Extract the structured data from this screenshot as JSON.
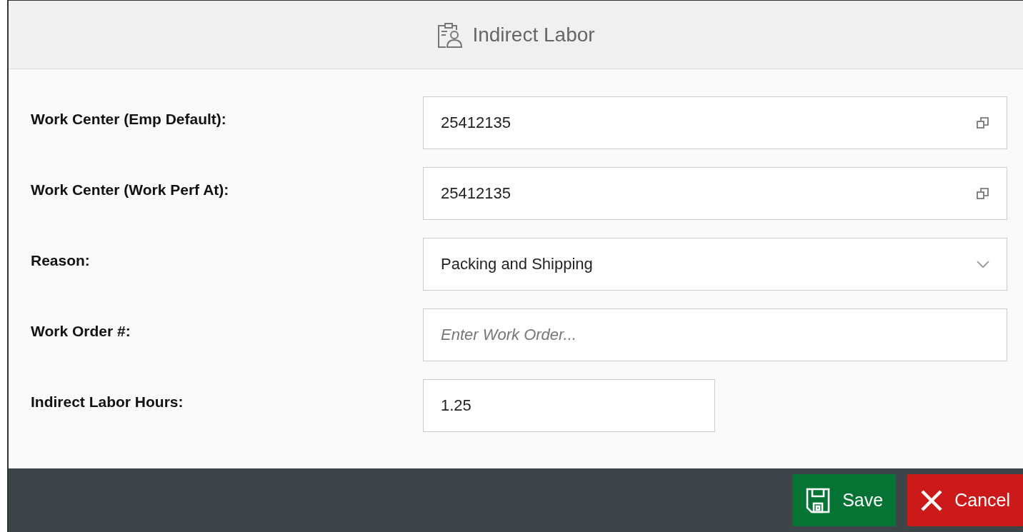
{
  "dialog": {
    "title": "Indirect Labor"
  },
  "fields": [
    {
      "label": "Work Center (Emp Default):",
      "kind": "lookup",
      "value": "25412135"
    },
    {
      "label": "Work Center (Work Perf At):",
      "kind": "lookup",
      "value": "25412135"
    },
    {
      "label": "Reason:",
      "kind": "select",
      "value": "Packing and Shipping"
    },
    {
      "label": "Work Order #:",
      "kind": "text",
      "placeholder": "Enter Work Order..."
    },
    {
      "label": "Indirect Labor Hours:",
      "kind": "short",
      "value": "1.25"
    }
  ],
  "buttons": [
    {
      "label": "Save",
      "kind": "save"
    },
    {
      "label": "Cancel",
      "kind": "cancel"
    }
  ]
}
